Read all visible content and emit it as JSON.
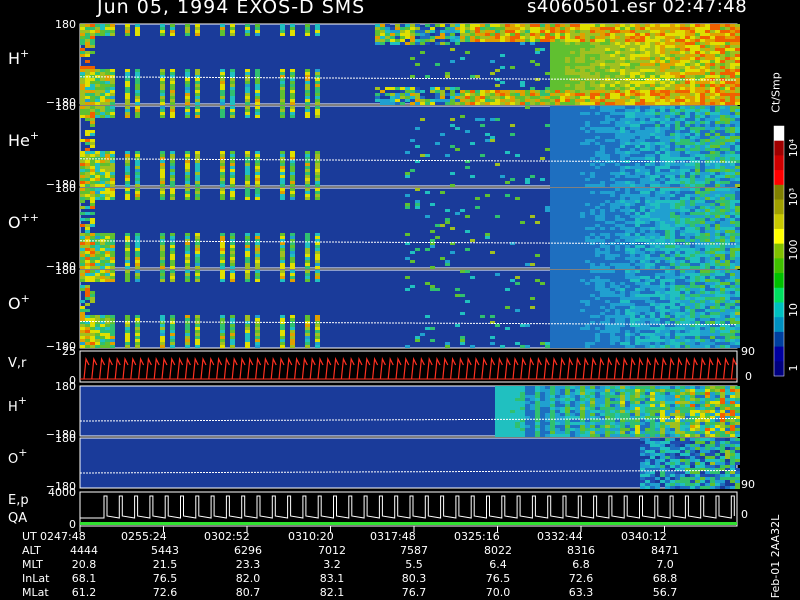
{
  "header": {
    "left_title": "Jun 05, 1994   EXOS-D SMS",
    "right_title": "s4060501.esr  02:47:48"
  },
  "colorbar": {
    "title": "Ct/Smp",
    "tick_labels": [
      "10⁴",
      "10³",
      "100",
      "10",
      "1"
    ],
    "colors": [
      "#ffffff",
      "#a00000",
      "#d00000",
      "#ff0000",
      "#808000",
      "#a0a000",
      "#c8c800",
      "#ffff00",
      "#80c000",
      "#40c000",
      "#00c000",
      "#00e060",
      "#00c0c0",
      "#0090c0",
      "#0040a0",
      "#0000a0",
      "#000080"
    ]
  },
  "footer": {
    "rows": [
      {
        "label": "UT",
        "values": [
          "0247:48",
          "0255:24",
          "0302:52",
          "0310:20",
          "0317:48",
          "0325:16",
          "0332:44",
          "0340:12"
        ]
      },
      {
        "label": "ALT",
        "values": [
          "4444",
          "5443",
          "6296",
          "7012",
          "7587",
          "8022",
          "8316",
          "8471"
        ]
      },
      {
        "label": "MLT",
        "values": [
          "20.8",
          "21.5",
          "23.3",
          "3.2",
          "5.5",
          "6.4",
          "6.8",
          "7.0"
        ]
      },
      {
        "label": "InLat",
        "values": [
          "68.1",
          "76.5",
          "82.0",
          "83.1",
          "80.3",
          "76.5",
          "72.6",
          "68.8"
        ]
      },
      {
        "label": "MLat",
        "values": [
          "61.2",
          "72.6",
          "80.7",
          "82.1",
          "76.7",
          "70.0",
          "63.3",
          "56.7"
        ]
      }
    ],
    "side_label": "Feb-01 2AA32L"
  },
  "chart_data": {
    "type": "heatmap",
    "title": "Jun 05, 1994   EXOS-D SMS",
    "x_tick_labels": [
      "0247:48",
      "0255:24",
      "0302:52",
      "0310:20",
      "0317:48",
      "0325:16",
      "0332:44",
      "0340:12"
    ],
    "panels": [
      {
        "id": "hplus-1",
        "label": "H",
        "sup": "+",
        "ytop": "180",
        "ybot": "−180",
        "right": ""
      },
      {
        "id": "heplus",
        "label": "He",
        "sup": "+",
        "ytop": "180",
        "ybot": "−180",
        "right": ""
      },
      {
        "id": "oplusplus",
        "label": "O",
        "sup": "++",
        "ytop": "180",
        "ybot": "−180",
        "right": ""
      },
      {
        "id": "oplus-1",
        "label": "O",
        "sup": "+",
        "ytop": "180",
        "ybot": "−180",
        "right": ""
      },
      {
        "id": "vr",
        "label": "V,r",
        "sup": "",
        "ytop": "25",
        "ybot": "0",
        "right": "90",
        "right_bottom": "0"
      },
      {
        "id": "hplus-2",
        "label": "H",
        "sup": "+",
        "ytop": "180",
        "ybot": "−180",
        "right": ""
      },
      {
        "id": "oplus-2",
        "label": "O",
        "sup": "+",
        "ytop": "180",
        "ybot": "−180",
        "right": "90"
      },
      {
        "id": "ep-qa",
        "label": "E,p",
        "label2": "QA",
        "sup": "",
        "ytop": "4000",
        "ybot": "0",
        "right": "0"
      }
    ],
    "colorbar_range": [
      "1",
      "10⁴"
    ],
    "colorbar_unit": "Ct/Smp"
  }
}
